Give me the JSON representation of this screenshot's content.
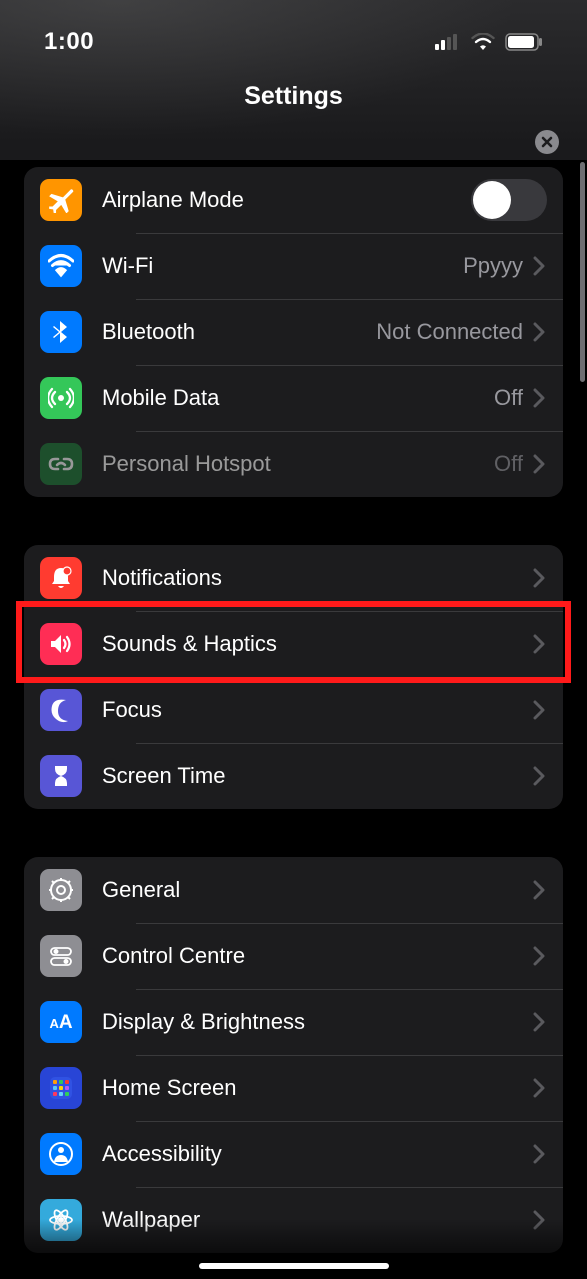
{
  "status": {
    "time": "1:00"
  },
  "page": {
    "title": "Settings"
  },
  "groups": [
    {
      "rows": [
        {
          "id": "airplane",
          "label": "Airplane Mode",
          "value": null,
          "type": "toggle",
          "toggled": false,
          "disabled": false,
          "icon": "airplane",
          "color": "#ff9500"
        },
        {
          "id": "wifi",
          "label": "Wi-Fi",
          "value": "Ppyyy",
          "type": "link",
          "disabled": false,
          "icon": "wifi",
          "color": "#007aff"
        },
        {
          "id": "bluetooth",
          "label": "Bluetooth",
          "value": "Not Connected",
          "type": "link",
          "disabled": false,
          "icon": "bluetooth",
          "color": "#007aff"
        },
        {
          "id": "mobile",
          "label": "Mobile Data",
          "value": "Off",
          "type": "link",
          "disabled": false,
          "icon": "antenna",
          "color": "#34c759"
        },
        {
          "id": "hotspot",
          "label": "Personal Hotspot",
          "value": "Off",
          "type": "link",
          "disabled": true,
          "icon": "link",
          "color": "#1f7a3a"
        }
      ]
    },
    {
      "rows": [
        {
          "id": "notifications",
          "label": "Notifications",
          "value": null,
          "type": "link",
          "disabled": false,
          "icon": "bell",
          "color": "#ff3b30"
        },
        {
          "id": "sounds",
          "label": "Sounds & Haptics",
          "value": null,
          "type": "link",
          "disabled": false,
          "icon": "speaker",
          "color": "#ff2d55",
          "highlight": true
        },
        {
          "id": "focus",
          "label": "Focus",
          "value": null,
          "type": "link",
          "disabled": false,
          "icon": "moon",
          "color": "#5856d6"
        },
        {
          "id": "screentime",
          "label": "Screen Time",
          "value": null,
          "type": "link",
          "disabled": false,
          "icon": "hourglass",
          "color": "#5856d6"
        }
      ]
    },
    {
      "rows": [
        {
          "id": "general",
          "label": "General",
          "value": null,
          "type": "link",
          "disabled": false,
          "icon": "gear",
          "color": "#8e8e93"
        },
        {
          "id": "controlcentre",
          "label": "Control Centre",
          "value": null,
          "type": "link",
          "disabled": false,
          "icon": "switches",
          "color": "#8e8e93"
        },
        {
          "id": "display",
          "label": "Display & Brightness",
          "value": null,
          "type": "link",
          "disabled": false,
          "icon": "aa",
          "color": "#007aff"
        },
        {
          "id": "homescreen",
          "label": "Home Screen",
          "value": null,
          "type": "link",
          "disabled": false,
          "icon": "grid",
          "color": "#2845d6"
        },
        {
          "id": "accessibility",
          "label": "Accessibility",
          "value": null,
          "type": "link",
          "disabled": false,
          "icon": "person",
          "color": "#007aff"
        },
        {
          "id": "wallpaper",
          "label": "Wallpaper",
          "value": null,
          "type": "link",
          "disabled": false,
          "icon": "flower",
          "color": "#34aadc"
        }
      ]
    }
  ]
}
